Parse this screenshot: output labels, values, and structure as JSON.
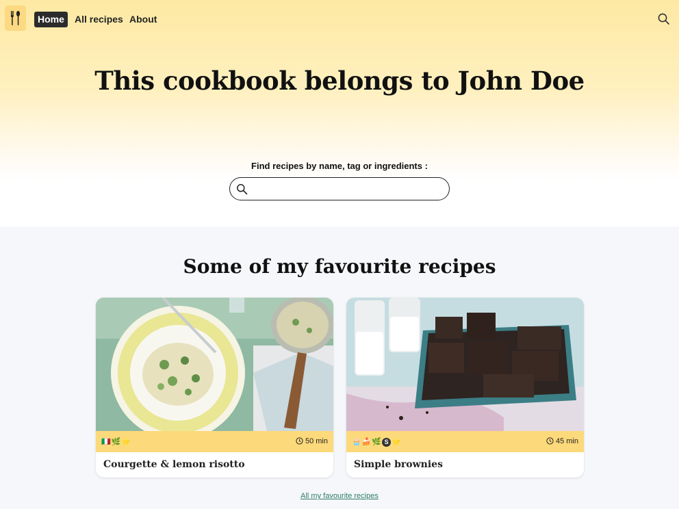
{
  "nav": {
    "logo_icon": "fork-spoon-icon",
    "items": [
      {
        "label": "Home",
        "active": true
      },
      {
        "label": "All recipes",
        "active": false
      },
      {
        "label": "About",
        "active": false
      }
    ],
    "search_icon": "search-icon"
  },
  "hero": {
    "title": "This cookbook belongs to John Doe",
    "search_label": "Find recipes by name, tag or ingredients :",
    "search_value": "",
    "search_placeholder": ""
  },
  "favourites": {
    "title": "Some of my favourite recipes",
    "recipes": [
      {
        "name": "Courgette & lemon risotto",
        "tags": [
          "🇮🇹",
          "🌿",
          "⭐"
        ],
        "time": "50 min"
      },
      {
        "name": "Simple brownies",
        "tags": [
          "🧁",
          "🍰",
          "🌿",
          "S",
          "⭐"
        ],
        "time": "45 min"
      }
    ],
    "all_link": "All my favourite recipes"
  },
  "colors": {
    "hero_gradient_top": "#fde9a3",
    "card_meta": "#fcd97a",
    "section_bg": "#f5f7fa",
    "link": "#2e7d6a",
    "active_nav": "#2b2b2b"
  }
}
